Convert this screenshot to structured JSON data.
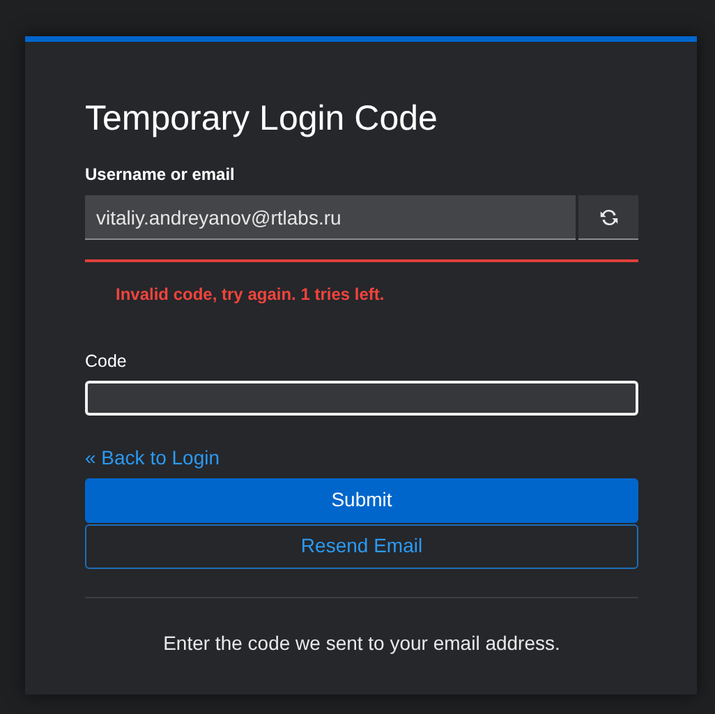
{
  "title": "Temporary Login Code",
  "username": {
    "label": "Username or email",
    "value": "vitaliy.andreyanov@rtlabs.ru"
  },
  "error": "Invalid code, try again. 1 tries left.",
  "code": {
    "label": "Code",
    "focused": true
  },
  "back_link": "« Back to Login",
  "buttons": [
    {
      "label": "Submit",
      "kind": "primary"
    },
    {
      "label": "Resend Email",
      "kind": "secondary"
    }
  ],
  "info": "Enter the code we sent to your email address."
}
